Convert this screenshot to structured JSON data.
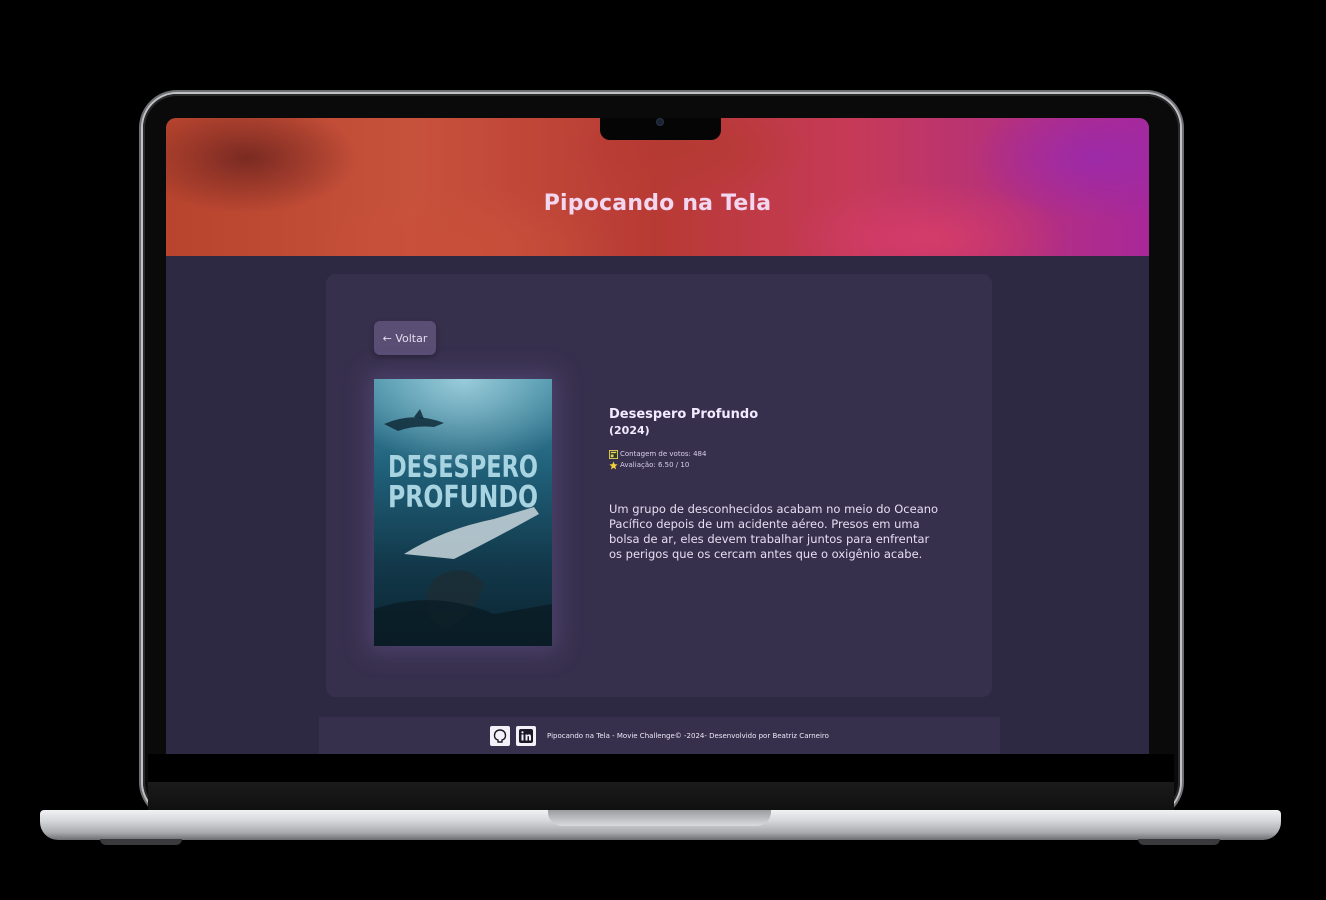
{
  "header": {
    "title": "Pipocando na Tela"
  },
  "detail": {
    "back_label": "← Voltar",
    "poster": {
      "title_line1": "DESESPERO",
      "title_line2": "PROFUNDO"
    },
    "title": "Desespero Profundo",
    "year": "(2024)",
    "vote_count": "Contagem de votos: 484",
    "rating": "Avaliação: 6.50 / 10",
    "overview": "Um grupo de desconhecidos acabam no meio do Oceano Pacífico depois de um acidente aéreo. Presos em uma bolsa de ar, eles devem trabalhar juntos para enfrentar os perigos que os cercam antes que o oxigênio acabe."
  },
  "footer": {
    "text": "Pipocando na Tela - Movie Challenge© -2024- Desenvolvido por Beatriz Carneiro",
    "icons": [
      "github-icon",
      "linkedin-icon"
    ]
  },
  "colors": {
    "page_bg": "#2e2942",
    "card_bg": "#37304d",
    "button_bg": "#5a4e75",
    "title_color": "#f3d6ef"
  }
}
